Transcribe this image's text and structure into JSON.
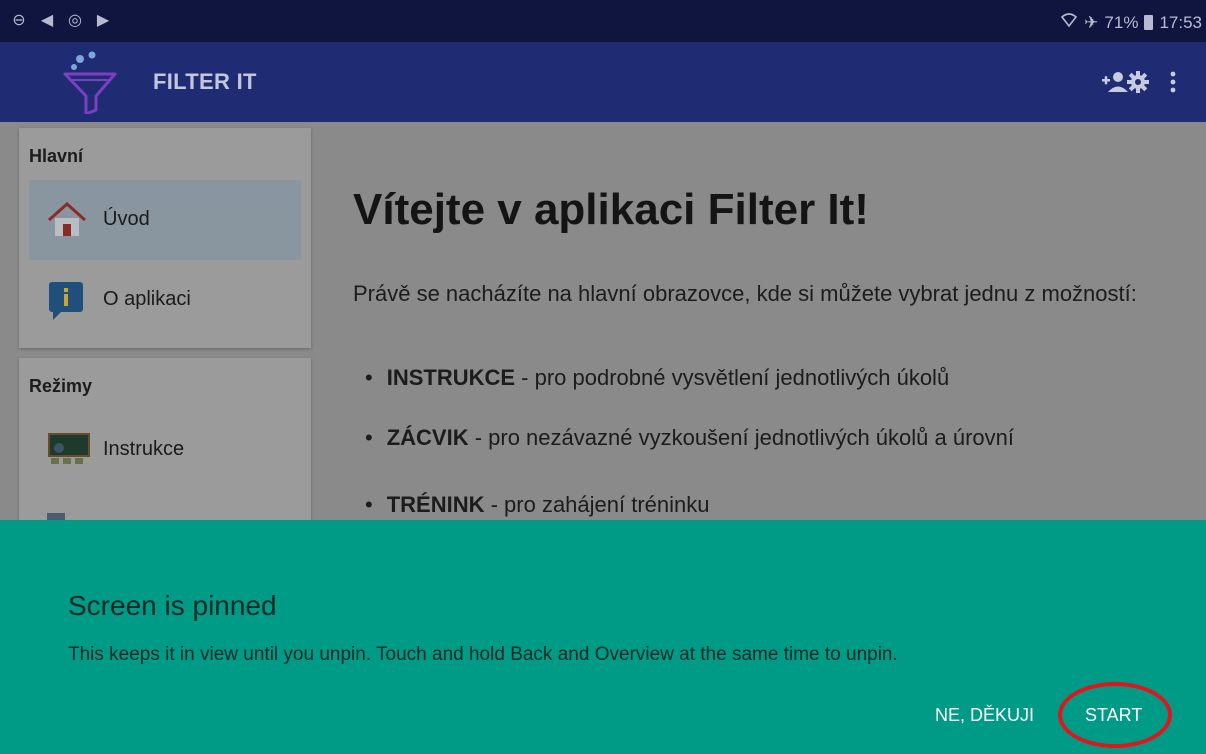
{
  "statusbar": {
    "left_icons": [
      "do-not-disturb-icon",
      "navigation-icon",
      "sync-icon",
      "play-icon"
    ],
    "battery": "71%",
    "time": "17:53"
  },
  "appbar": {
    "title": "FILTER IT",
    "icons": [
      "add-user-icon",
      "settings-gear-icon",
      "overflow-menu-icon"
    ]
  },
  "drawer": {
    "sections": [
      {
        "title": "Hlavní",
        "items": [
          {
            "label": "Úvod",
            "icon": "home-icon",
            "selected": true
          },
          {
            "label": "O aplikaci",
            "icon": "info-icon",
            "selected": false
          }
        ]
      },
      {
        "title": "Režimy",
        "items": [
          {
            "label": "Instrukce",
            "icon": "blackboard-icon",
            "selected": false
          }
        ]
      }
    ]
  },
  "main": {
    "headline": "Vítejte v aplikaci Filter It!",
    "intro": "Právě se nacházíte na hlavní obrazovce, kde si můžete vybrat jednu z možností:",
    "bullets": [
      {
        "term": "INSTRUKCE",
        "desc": " - pro podrobné vysvětlení jednotlivých úkolů"
      },
      {
        "term": "ZÁCVIK",
        "desc": " - pro nezávazné vyzkoušení jednotlivých úkolů a úrovní"
      },
      {
        "term": "TRÉNINK",
        "desc": " - pro zahájení tréninku"
      }
    ]
  },
  "pin_dialog": {
    "title": "Screen is pinned",
    "body": "This keeps it in view until you unpin. Touch and hold Back and Overview at the same time to unpin.",
    "decline_label": "NE, DĚKUJI",
    "start_label": "START"
  },
  "colors": {
    "statusbar": "#101540",
    "appbar": "#1f2b72",
    "sheet": "#009b87",
    "highlight": "#e0161b"
  }
}
